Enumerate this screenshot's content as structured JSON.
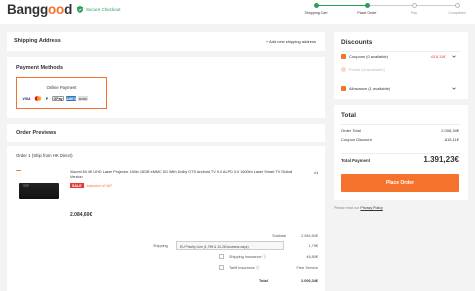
{
  "header": {
    "logo_prefix": "Bangg",
    "logo_o": "oo",
    "logo_suffix": "d",
    "secure": "Secure Checkout",
    "steps": [
      {
        "label": "Shopping Cart",
        "state": "done"
      },
      {
        "label": "Place Order",
        "state": "active"
      },
      {
        "label": "Pay",
        "state": "todo"
      },
      {
        "label": "Completed",
        "state": "todo"
      }
    ]
  },
  "shipping_address": {
    "title": "Shipping Address",
    "add_link": "+ Add new shipping address"
  },
  "payment": {
    "title": "Payment Methods",
    "option_label": "Online Payment",
    "cards": [
      "VISA",
      "MC",
      "P",
      "GPay",
      "AMEX",
      "BANK"
    ]
  },
  "order_previews": {
    "title": "Order Previews",
    "order_line": "Order 1 (Ship from HK Direct)",
    "product_title": "Xiaomi Mi 4K UHD Laser Projector 150in 16GB eMMC 5G With Dolby DTS Android TV 9.0 ALPD 3.0 1600lm Laser Smart TV Global Version",
    "qty": "x1",
    "sale_badge": "SALE",
    "vat_note": "Inclusive of VAT",
    "price": "2.084,60€",
    "subtotal_label": "Subtotal",
    "subtotal_value": "2.084,60€",
    "shipping_label": "Shipping",
    "shipping_option": "EU Priority Line (1,79€ & 10-26 business days)",
    "shipping_value": "1,79€",
    "ship_ins_label": "Shipping Insurance ⓘ",
    "ship_ins_value": "48,80€",
    "tariff_label": "Tariff Insurance ⓘ",
    "tariff_value": "Free Service",
    "total_label": "Total",
    "total_value": "2.006,34€"
  },
  "discounts": {
    "title": "Discounts",
    "coupons": "Coupons (0 available)",
    "coupons_value": "-615,11€",
    "points": "Points (Unavailable)",
    "allowance": "Allowance (1 available)"
  },
  "totals": {
    "title": "Total",
    "order_total_label": "Order Total",
    "order_total_value": "2.006,34€",
    "coupon_discount_label": "Coupon Discount",
    "coupon_discount_value": "-615,11€",
    "total_payment_label": "Total Payment",
    "total_payment_value": "1.391,23€",
    "place_order": "Place Order",
    "privacy_prefix": "Please read our",
    "privacy_link": "Privacy Policy"
  },
  "colors": {
    "accent": "#f5722c",
    "green": "#2e9e5b",
    "link": "#3b7bd6"
  }
}
